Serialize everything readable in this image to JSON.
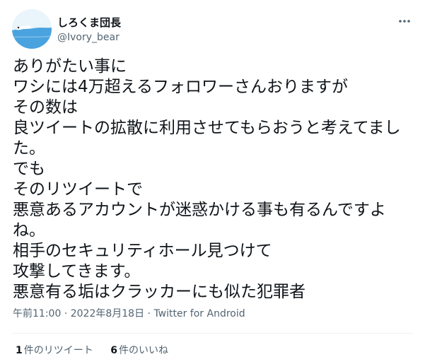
{
  "author": {
    "display_name": "しろくま団長",
    "handle": "@Ivory_bear"
  },
  "tweet": {
    "lines": [
      "ありがたい事に",
      "ワシには4万超えるフォロワーさんおりますが",
      "その数は",
      "良ツイートの拡散に利用させてもらおうと考えてまし",
      "た。",
      "でも",
      "そのリツイートで",
      "悪意あるアカウントが迷惑かける事も有るんですよ",
      "ね。",
      "相手のセキュリティホール見つけて",
      "攻撃してきます。",
      "悪意有る垢はクラッカーにも似た犯罪者"
    ]
  },
  "meta": {
    "time": "午前11:00",
    "separator": " · ",
    "date": "2022年8月18日",
    "source": "Twitter for Android"
  },
  "stats": {
    "retweets_count": "1",
    "retweets_label": "件のリツイート",
    "likes_count": "6",
    "likes_label": "件のいいね"
  },
  "icons": {
    "more": "more-horizontal-icon",
    "avatar": "polar-bear-avatar"
  }
}
